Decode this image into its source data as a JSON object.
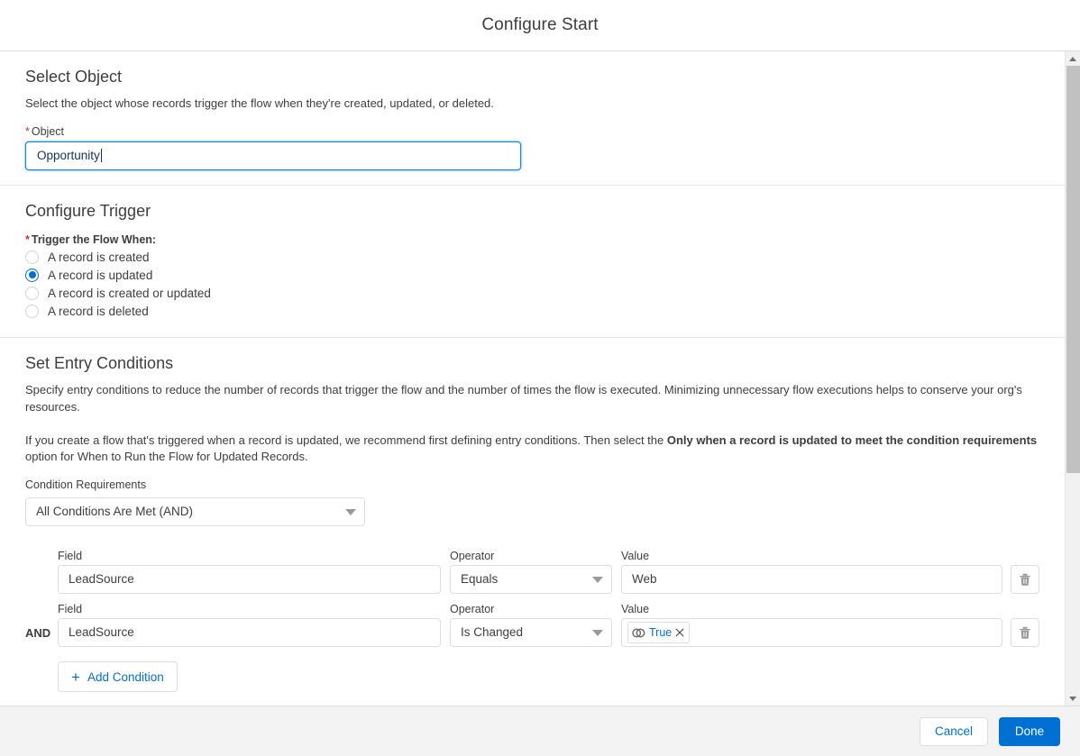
{
  "header": {
    "title": "Configure Start"
  },
  "select_object": {
    "title": "Select Object",
    "description": "Select the object whose records trigger the flow when they're created, updated, or deleted.",
    "field_label": "Object",
    "required_marker": "*",
    "value": "Opportunity"
  },
  "configure_trigger": {
    "title": "Configure Trigger",
    "field_label": "Trigger the Flow When:",
    "required_marker": "*",
    "options": [
      {
        "label": "A record is created",
        "selected": false
      },
      {
        "label": "A record is updated",
        "selected": true
      },
      {
        "label": "A record is created or updated",
        "selected": false
      },
      {
        "label": "A record is deleted",
        "selected": false
      }
    ]
  },
  "entry_conditions": {
    "title": "Set Entry Conditions",
    "description_1": "Specify entry conditions to reduce the number of records that trigger the flow and the number of times the flow is executed. Minimizing unnecessary flow executions helps to conserve your org's resources.",
    "description_2_part_1": "If you create a flow that's triggered when a record is updated, we recommend first defining entry conditions. Then select the ",
    "description_2_bold": "Only when a record is updated to meet the condition requirements",
    "description_2_part_2": " option for When to Run the Flow for Updated Records.",
    "condition_requirements_label": "Condition Requirements",
    "condition_requirements_value": "All Conditions Are Met (AND)",
    "column_headers": {
      "field": "Field",
      "operator": "Operator",
      "value": "Value"
    },
    "rows": [
      {
        "logic": "",
        "field": "LeadSource",
        "operator": "Equals",
        "value": "Web",
        "value_is_pill": false,
        "delete_icon": "trash-icon"
      },
      {
        "logic": "AND",
        "field": "LeadSource",
        "operator": "Is Changed",
        "value": "True",
        "value_is_pill": true,
        "pill_icon": "global-constant-icon",
        "pill_remove_icon": "close-icon",
        "delete_icon": "trash-icon"
      }
    ],
    "add_condition_label": "Add Condition",
    "add_condition_icon": "plus-icon"
  },
  "footer": {
    "cancel_label": "Cancel",
    "done_label": "Done"
  },
  "scrollbar": {
    "up_icon": "chevron-up-icon",
    "down_icon": "chevron-down-icon"
  },
  "colors": {
    "brand_blue": "#0070d2",
    "focus_blue": "#1589ee",
    "required_red": "#c23934",
    "text": "#3e3e3c",
    "border": "#d8dde6",
    "footer_bg": "#f3f3f3"
  }
}
